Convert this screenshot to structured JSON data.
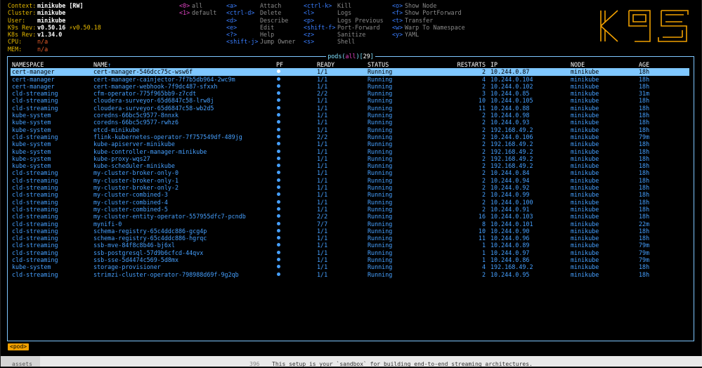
{
  "info": [
    {
      "key": "Context:",
      "value": "minikube [RW]",
      "style": "v"
    },
    {
      "key": "Cluster:",
      "value": "minikube",
      "style": "v"
    },
    {
      "key": "User:",
      "value": "minikube",
      "style": "v"
    },
    {
      "key": "K9s Rev:",
      "value": "v0.50.16",
      "extra": "⚡v0.50.18",
      "style": "v"
    },
    {
      "key": "K8s Rev:",
      "value": "v1.34.0",
      "style": "v"
    },
    {
      "key": "CPU:",
      "value": "n/a",
      "style": "warn"
    },
    {
      "key": "MEM:",
      "value": "n/a",
      "style": "warn"
    }
  ],
  "namespaces": [
    {
      "key": "<0>",
      "label": "all"
    },
    {
      "key": "<1>",
      "label": "default"
    }
  ],
  "shortcuts_col1": [
    {
      "key": "<a>",
      "label": "Attach"
    },
    {
      "key": "<ctrl-d>",
      "label": "Delete"
    },
    {
      "key": "<d>",
      "label": "Describe"
    },
    {
      "key": "<e>",
      "label": "Edit"
    },
    {
      "key": "<?>",
      "label": "Help"
    },
    {
      "key": "<shift-j>",
      "label": "Jump Owner"
    }
  ],
  "shortcuts_col2": [
    {
      "key": "<ctrl-k>",
      "label": "Kill"
    },
    {
      "key": "<l>",
      "label": "Logs"
    },
    {
      "key": "<p>",
      "label": "Logs Previous"
    },
    {
      "key": "<shift-f>",
      "label": "Port-Forward"
    },
    {
      "key": "<z>",
      "label": "Sanitize"
    },
    {
      "key": "<s>",
      "label": "Shell"
    }
  ],
  "shortcuts_col3": [
    {
      "key": "<o>",
      "label": "Show Node"
    },
    {
      "key": "<f>",
      "label": "Show PortForward"
    },
    {
      "key": "<t>",
      "label": "Transfer"
    },
    {
      "key": "<w>",
      "label": "Warp To Namespace"
    },
    {
      "key": "<y>",
      "label": "YAML"
    }
  ],
  "logo": {
    "text": "K9s",
    "color": "#f0a000"
  },
  "panel": {
    "resource": "pods",
    "filter": "all",
    "count": "29"
  },
  "columns": {
    "namespace": "NAMESPACE",
    "name": "NAME",
    "sort": "↑",
    "pf": "PF",
    "ready": "READY",
    "status": "STATUS",
    "restarts": "RESTARTS",
    "ip": "IP",
    "node": "NODE",
    "age": "AGE"
  },
  "pods": [
    {
      "ns": "cert-manager",
      "name": "cert-manager-546dcc75c-wsw6f",
      "ready": "1/1",
      "status": "Running",
      "restarts": "2",
      "ip": "10.244.0.87",
      "node": "minikube",
      "age": "18h"
    },
    {
      "ns": "cert-manager",
      "name": "cert-manager-cainjector-7f7b5db964-2wc9m",
      "ready": "1/1",
      "status": "Running",
      "restarts": "4",
      "ip": "10.244.0.104",
      "node": "minikube",
      "age": "18h"
    },
    {
      "ns": "cert-manager",
      "name": "cert-manager-webhook-7f9dc487-sfxxh",
      "ready": "1/1",
      "status": "Running",
      "restarts": "2",
      "ip": "10.244.0.102",
      "node": "minikube",
      "age": "18h"
    },
    {
      "ns": "cld-streaming",
      "name": "cfm-operator-775f965bb9-z7cdt",
      "ready": "2/2",
      "status": "Running",
      "restarts": "3",
      "ip": "10.244.0.85",
      "node": "minikube",
      "age": "31m"
    },
    {
      "ns": "cld-streaming",
      "name": "cloudera-surveyor-65d6847c58-lrw8j",
      "ready": "1/1",
      "status": "Running",
      "restarts": "10",
      "ip": "10.244.0.105",
      "node": "minikube",
      "age": "18h"
    },
    {
      "ns": "cld-streaming",
      "name": "cloudera-surveyor-65d6847c58-wb2d5",
      "ready": "1/1",
      "status": "Running",
      "restarts": "11",
      "ip": "10.244.0.88",
      "node": "minikube",
      "age": "18h"
    },
    {
      "ns": "kube-system",
      "name": "coredns-66bc5c9577-8nnxk",
      "ready": "1/1",
      "status": "Running",
      "restarts": "2",
      "ip": "10.244.0.98",
      "node": "minikube",
      "age": "18h"
    },
    {
      "ns": "kube-system",
      "name": "coredns-66bc5c9577-rwhz6",
      "ready": "1/1",
      "status": "Running",
      "restarts": "2",
      "ip": "10.244.0.93",
      "node": "minikube",
      "age": "18h"
    },
    {
      "ns": "kube-system",
      "name": "etcd-minikube",
      "ready": "1/1",
      "status": "Running",
      "restarts": "2",
      "ip": "192.168.49.2",
      "node": "minikube",
      "age": "18h"
    },
    {
      "ns": "cld-streaming",
      "name": "flink-kubernetes-operator-7f757549df-489jg",
      "ready": "2/2",
      "status": "Running",
      "restarts": "2",
      "ip": "10.244.0.106",
      "node": "minikube",
      "age": "79m"
    },
    {
      "ns": "kube-system",
      "name": "kube-apiserver-minikube",
      "ready": "1/1",
      "status": "Running",
      "restarts": "2",
      "ip": "192.168.49.2",
      "node": "minikube",
      "age": "18h"
    },
    {
      "ns": "kube-system",
      "name": "kube-controller-manager-minikube",
      "ready": "1/1",
      "status": "Running",
      "restarts": "2",
      "ip": "192.168.49.2",
      "node": "minikube",
      "age": "18h"
    },
    {
      "ns": "kube-system",
      "name": "kube-proxy-wqs27",
      "ready": "1/1",
      "status": "Running",
      "restarts": "2",
      "ip": "192.168.49.2",
      "node": "minikube",
      "age": "18h"
    },
    {
      "ns": "kube-system",
      "name": "kube-scheduler-minikube",
      "ready": "1/1",
      "status": "Running",
      "restarts": "2",
      "ip": "192.168.49.2",
      "node": "minikube",
      "age": "18h"
    },
    {
      "ns": "cld-streaming",
      "name": "my-cluster-broker-only-0",
      "ready": "1/1",
      "status": "Running",
      "restarts": "2",
      "ip": "10.244.0.84",
      "node": "minikube",
      "age": "18h"
    },
    {
      "ns": "cld-streaming",
      "name": "my-cluster-broker-only-1",
      "ready": "1/1",
      "status": "Running",
      "restarts": "2",
      "ip": "10.244.0.94",
      "node": "minikube",
      "age": "18h"
    },
    {
      "ns": "cld-streaming",
      "name": "my-cluster-broker-only-2",
      "ready": "1/1",
      "status": "Running",
      "restarts": "2",
      "ip": "10.244.0.92",
      "node": "minikube",
      "age": "18h"
    },
    {
      "ns": "cld-streaming",
      "name": "my-cluster-combined-3",
      "ready": "1/1",
      "status": "Running",
      "restarts": "2",
      "ip": "10.244.0.99",
      "node": "minikube",
      "age": "18h"
    },
    {
      "ns": "cld-streaming",
      "name": "my-cluster-combined-4",
      "ready": "1/1",
      "status": "Running",
      "restarts": "2",
      "ip": "10.244.0.100",
      "node": "minikube",
      "age": "18h"
    },
    {
      "ns": "cld-streaming",
      "name": "my-cluster-combined-5",
      "ready": "1/1",
      "status": "Running",
      "restarts": "2",
      "ip": "10.244.0.91",
      "node": "minikube",
      "age": "18h"
    },
    {
      "ns": "cld-streaming",
      "name": "my-cluster-entity-operator-557955dfc7-pcndb",
      "ready": "2/2",
      "status": "Running",
      "restarts": "16",
      "ip": "10.244.0.103",
      "node": "minikube",
      "age": "18h"
    },
    {
      "ns": "cld-streaming",
      "name": "mynifi-0",
      "ready": "7/7",
      "status": "Running",
      "restarts": "8",
      "ip": "10.244.0.101",
      "node": "minikube",
      "age": "22m"
    },
    {
      "ns": "cld-streaming",
      "name": "schema-registry-65c4ddc886-gcg4p",
      "ready": "1/1",
      "status": "Running",
      "restarts": "10",
      "ip": "10.244.0.90",
      "node": "minikube",
      "age": "18h"
    },
    {
      "ns": "cld-streaming",
      "name": "schema-registry-65c4ddc886-hgrqc",
      "ready": "1/1",
      "status": "Running",
      "restarts": "11",
      "ip": "10.244.0.96",
      "node": "minikube",
      "age": "18h"
    },
    {
      "ns": "cld-streaming",
      "name": "ssb-mve-84f8c8b46-bj6xl",
      "ready": "1/1",
      "status": "Running",
      "restarts": "1",
      "ip": "10.244.0.89",
      "node": "minikube",
      "age": "79m"
    },
    {
      "ns": "cld-streaming",
      "name": "ssb-postgresql-57d9b6cfcd-44qvx",
      "ready": "1/1",
      "status": "Running",
      "restarts": "1",
      "ip": "10.244.0.97",
      "node": "minikube",
      "age": "79m"
    },
    {
      "ns": "cld-streaming",
      "name": "ssb-sse-5d4474c569-5d8mx",
      "ready": "1/1",
      "status": "Running",
      "restarts": "1",
      "ip": "10.244.0.86",
      "node": "minikube",
      "age": "79m"
    },
    {
      "ns": "kube-system",
      "name": "storage-provisioner",
      "ready": "1/1",
      "status": "Running",
      "restarts": "4",
      "ip": "192.168.49.2",
      "node": "minikube",
      "age": "18h"
    },
    {
      "ns": "cld-streaming",
      "name": "strimzi-cluster-operator-798988d69f-9g2qb",
      "ready": "1/1",
      "status": "Running",
      "restarts": "2",
      "ip": "10.244.0.95",
      "node": "minikube",
      "age": "18h"
    }
  ],
  "breadcrumb": "<pod>",
  "underlying": {
    "left": "assets",
    "line_no": "396",
    "text": "This setup is your `sandbox` for building end-to-end streaming architectures."
  }
}
